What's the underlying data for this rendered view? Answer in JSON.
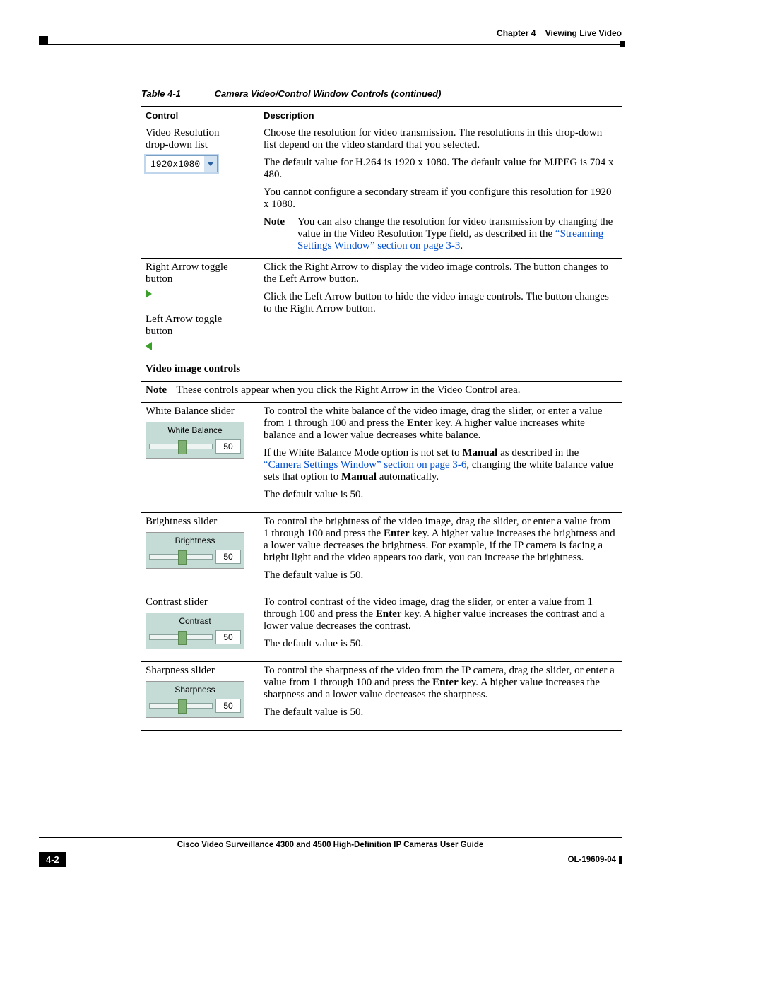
{
  "header": {
    "chapter": "Chapter 4",
    "section": "Viewing Live Video"
  },
  "table": {
    "caption_num": "Table 4-1",
    "caption_title": "Camera Video/Control Window Controls (continued)",
    "headers": {
      "control": "Control",
      "description": "Description"
    }
  },
  "rows": {
    "resolution": {
      "label1": "Video Resolution",
      "label2": "drop-down list",
      "dropdown_value": "1920x1080",
      "p1": "Choose the resolution for video transmission. The resolutions in this drop-down list depend on the video standard that you selected.",
      "p2": "The default value for H.264 is 1920 x 1080. The default value for MJPEG is 704 x 480.",
      "p3": "You cannot configure a secondary stream if you configure this resolution for 1920 x 1080.",
      "note_label": "Note",
      "note_text": "You can also change the resolution for video transmission by changing the value in the Video Resolution Type field, as described in the ",
      "note_link": "“Streaming Settings Window” section on page 3-3",
      "note_tail": "."
    },
    "arrows": {
      "right1": "Right Arrow toggle",
      "right2": "button",
      "left1": "Left Arrow toggle",
      "left2": "button",
      "p1": "Click the Right Arrow to display the video image controls. The button changes to the Left Arrow button.",
      "p2": "Click the Left Arrow button to hide the video image controls. The button changes to the Right Arrow button."
    },
    "section": {
      "title": "Video image controls",
      "note_label": "Note",
      "note_text": "These controls appear when you click the Right Arrow in the Video Control area."
    },
    "wb": {
      "label": "White Balance slider",
      "widget_label": "White Balance",
      "widget_value": "50",
      "p1a": "To control the white balance of the video image, drag the slider, or enter a value from 1 through 100 and press the ",
      "enter": "Enter",
      "p1b": " key. A higher value increases white balance and a lower value decreases white balance.",
      "p2a": "If the White Balance Mode option is not set to ",
      "manual": "Manual",
      "p2b": " as described in the ",
      "link": "“Camera Settings Window” section on page 3-6",
      "p2c": ", changing the white balance value sets that option to ",
      "p2d": " automatically.",
      "p3": "The default value is 50."
    },
    "brightness": {
      "label": "Brightness slider",
      "widget_label": "Brightness",
      "widget_value": "50",
      "p1a": "To control the brightness of the video image, drag the slider, or enter a value from 1 through 100 and press the ",
      "enter": "Enter",
      "p1b": " key. A higher value increases the brightness and a lower value decreases the brightness. For example, if the IP camera is facing a bright light and the video appears too dark, you can increase the brightness.",
      "p2": "The default value is 50."
    },
    "contrast": {
      "label": "Contrast slider",
      "widget_label": "Contrast",
      "widget_value": "50",
      "p1a": "To control contrast of the video image, drag the slider, or enter a value from 1 through 100 and press the ",
      "enter": "Enter",
      "p1b": " key. A higher value increases the contrast and a lower value decreases the contrast.",
      "p2": "The default value is 50."
    },
    "sharpness": {
      "label": "Sharpness slider",
      "widget_label": "Sharpness",
      "widget_value": "50",
      "p1a": "To control the sharpness of the video from the IP camera, drag the slider, or enter a value from 1 through 100 and press the ",
      "enter": "Enter",
      "p1b": " key. A higher value increases the sharpness and a lower value decreases the sharpness.",
      "p2": "The default value is 50."
    }
  },
  "footer": {
    "title": "Cisco Video Surveillance 4300 and 4500 High-Definition IP Cameras User Guide",
    "page": "4-2",
    "docid": "OL-19609-04"
  }
}
